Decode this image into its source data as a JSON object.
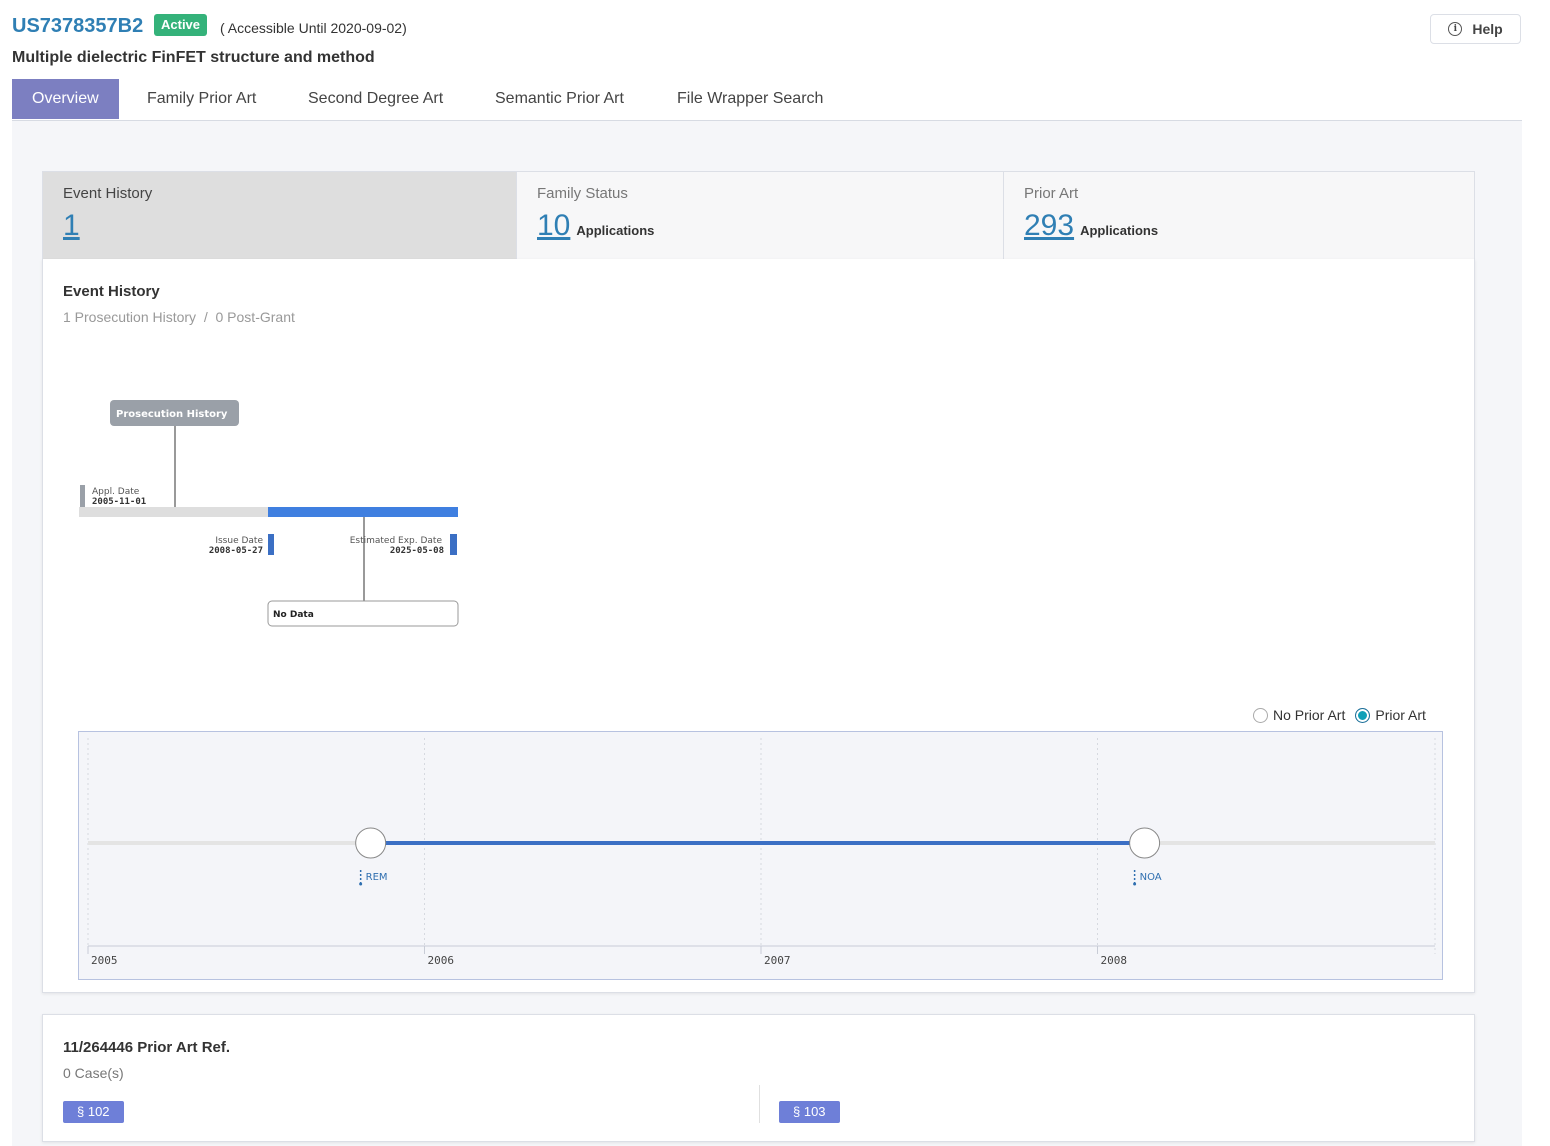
{
  "header": {
    "patent_id": "US7378357B2",
    "status": "Active",
    "access_note": "( Accessible Until 2020-09-02)",
    "title": "Multiple dielectric FinFET structure and method",
    "help_label": "Help",
    "help_icon": "info-icon"
  },
  "tabs": [
    {
      "label": "Overview",
      "active": true
    },
    {
      "label": "Family Prior Art"
    },
    {
      "label": "Second Degree Art"
    },
    {
      "label": "Semantic Prior Art"
    },
    {
      "label": "File Wrapper Search"
    }
  ],
  "summary": [
    {
      "label": "Event History",
      "value": "1",
      "unit": "",
      "selected": true
    },
    {
      "label": "Family Status",
      "value": "10",
      "unit": "Applications"
    },
    {
      "label": "Prior Art",
      "value": "293",
      "unit": "Applications"
    }
  ],
  "event_history": {
    "title": "Event History",
    "subtitle": "1 Prosecution History  /  0 Post-Grant",
    "diagram": {
      "callout_label": "Prosecution History",
      "appl_label": "Appl. Date",
      "appl_date": "2005-11-01",
      "issue_label": "Issue Date",
      "issue_date": "2008-05-27",
      "exp_label": "Estimated Exp. Date",
      "exp_date": "2025-05-08",
      "no_data_label": "No Data"
    },
    "filter": {
      "option_no_prior_art": "No Prior Art",
      "option_prior_art": "Prior Art",
      "selected": "Prior Art"
    },
    "timeline": {
      "years": [
        "2005",
        "2006",
        "2007",
        "2008"
      ],
      "events": [
        {
          "label": "REM",
          "year_fraction": 2005.84
        },
        {
          "label": "NOA",
          "year_fraction": 2008.14
        }
      ],
      "colors": {
        "active": "#3b6fc4",
        "inactive": "#e4e4e4"
      }
    }
  },
  "prior_art_ref": {
    "title": "11/264446 Prior Art Ref.",
    "count": "0 Case(s)",
    "tags": [
      "§ 102",
      "§ 103"
    ]
  }
}
